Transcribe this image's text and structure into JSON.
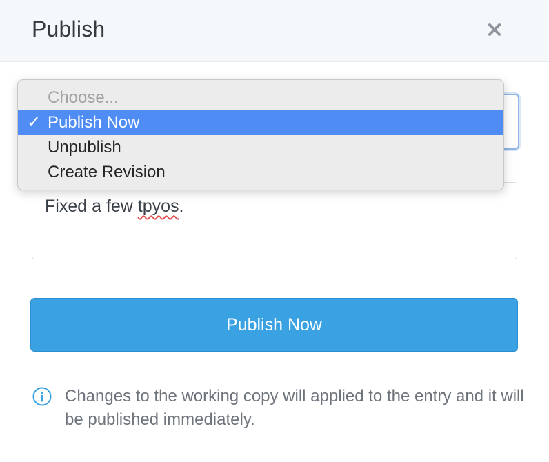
{
  "dialog": {
    "title": "Publish",
    "close_icon": "close-icon"
  },
  "select": {
    "options": [
      {
        "label": "Choose...",
        "placeholder": true
      },
      {
        "label": "Publish Now",
        "selected": true
      },
      {
        "label": "Unpublish"
      },
      {
        "label": "Create Revision"
      }
    ],
    "check_mark": "✓",
    "selected_value": "Publish Now"
  },
  "message": {
    "text_before_typo": "Fixed a few ",
    "typo_word": "tpyos",
    "text_after_typo": "."
  },
  "button": {
    "label": "Publish Now"
  },
  "info": {
    "icon": "info-icon",
    "text": "Changes to the working copy will applied to the entry and it will be published immediately."
  },
  "colors": {
    "accent": "#3aa2e2",
    "selection": "#4f8df5",
    "header_bg": "#f5f8fb",
    "info_icon": "#3aa2e2"
  }
}
